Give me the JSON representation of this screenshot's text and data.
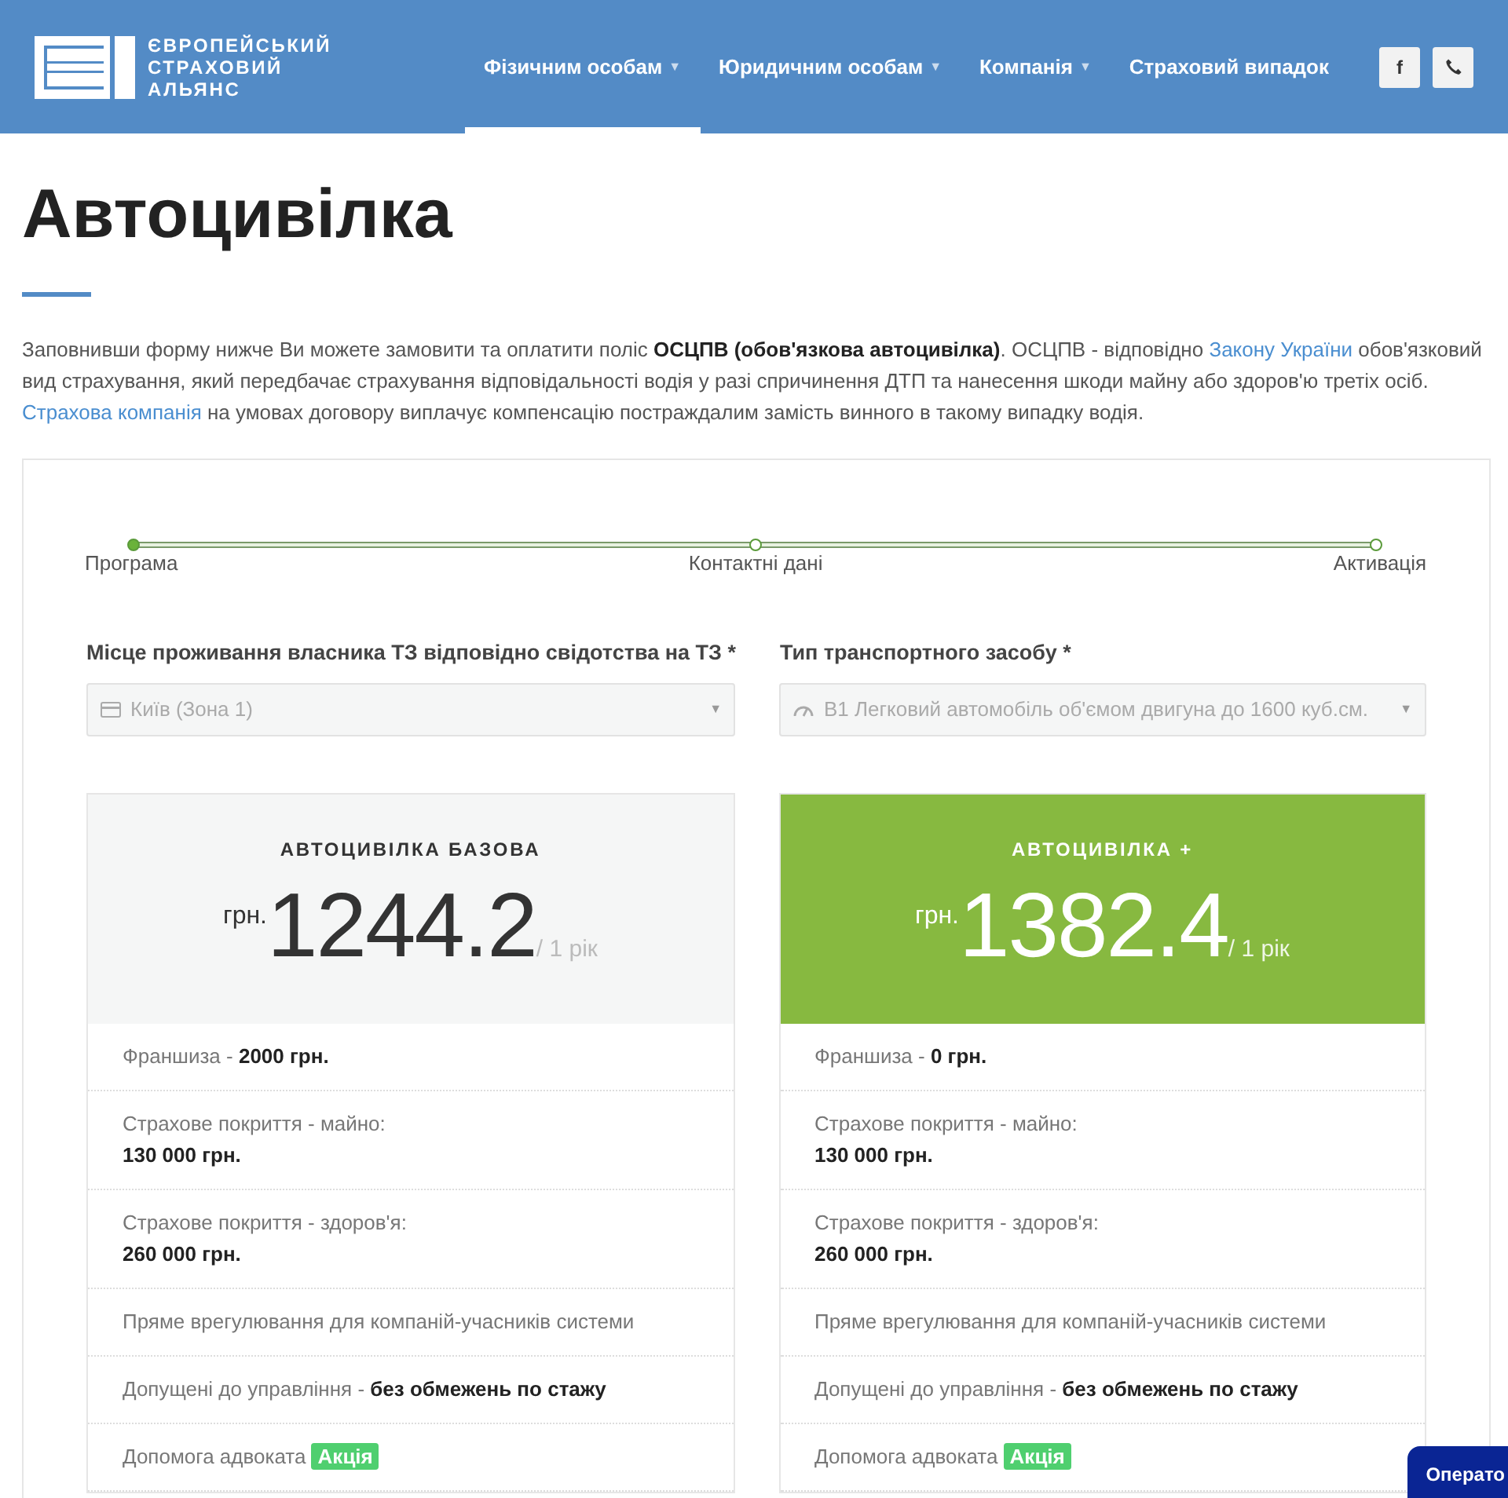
{
  "logo": {
    "lines": [
      "ЄВРОПЕЙСЬКИЙ",
      "СТРАХОВИЙ",
      "АЛЬЯНС"
    ]
  },
  "menu": [
    {
      "label": "Фізичним особам",
      "caret": "▼",
      "selected": true
    },
    {
      "label": "Юридичним особам",
      "caret": "▼",
      "selected": false
    },
    {
      "label": "Компанія",
      "caret": "▼",
      "selected": false
    },
    {
      "label": "Страховий випадок",
      "selected": false
    }
  ],
  "social": [
    {
      "kind": "facebook",
      "glyph": "f"
    },
    {
      "kind": "phone"
    }
  ],
  "title": "Автоцивілка",
  "intro": [
    {
      "kind": "text",
      "text": "Заповнивши форму нижче Ви можете замовити та оплатити поліс "
    },
    {
      "kind": "bold",
      "text": "ОСЦПВ (обов'язкова автоцивілка)"
    },
    {
      "kind": "text",
      "text": ". ОСЦПВ - відповідно "
    },
    {
      "kind": "link",
      "text": "Закону України"
    },
    {
      "kind": "text",
      "text": " обов'язковий вид страхування, який передбачає страхування відповідальності водія у разі спричинення ДТП та нанесення шкоди майну або здоров'ю третіх осіб. "
    },
    {
      "kind": "link",
      "text": "Страхова компанія"
    },
    {
      "kind": "text",
      "text": " на умовах договору виплачує компенсацію постраждалим замість винного в такому випадку водія."
    }
  ],
  "steps": [
    {
      "label": "Програма",
      "reached": true
    },
    {
      "label": "Контактні дані",
      "reached": false
    },
    {
      "label": "Активація",
      "reached": false
    }
  ],
  "fields": [
    {
      "label": "Місце проживання власника ТЗ відповідно свідотства на ТЗ *",
      "value": "Київ (Зона 1)",
      "kind": "region",
      "caret": "▼"
    },
    {
      "label": "Тип транспортного засобу *",
      "value": "B1 Легковий автомобіль об'ємом двигуна до 1600 куб.см.",
      "kind": "vehicle",
      "caret": "▼"
    }
  ],
  "plans": [
    {
      "name": "АВТОЦИВІЛКА БАЗОВА",
      "featured": false,
      "currency": "грн.",
      "price": "1244.2",
      "period": "/ 1 рік",
      "features": [
        {
          "kind": "inline",
          "label": "Франшиза - ",
          "value": "2000 грн."
        },
        {
          "kind": "stacked",
          "label": "Страхове покриття - майно:",
          "value": "130 000 грн."
        },
        {
          "kind": "stacked",
          "label": "Страхове покриття - здоров'я:",
          "value": "260 000 грн."
        },
        {
          "kind": "plain",
          "label": "Пряме врегулювання для компаній-учасників системи"
        },
        {
          "kind": "inline",
          "label": "Допущені до управління - ",
          "value": "без обмежень по стажу"
        },
        {
          "kind": "badge",
          "label": "Допомога адвоката ",
          "badge": "Акція"
        }
      ]
    },
    {
      "name": "АВТОЦИВІЛКА +",
      "featured": true,
      "currency": "грн.",
      "price": "1382.4",
      "period": "/ 1 рік",
      "features": [
        {
          "kind": "inline",
          "label": "Франшиза - ",
          "value": "0 грн."
        },
        {
          "kind": "stacked",
          "label": "Страхове покриття - майно:",
          "value": "130 000 грн."
        },
        {
          "kind": "stacked",
          "label": "Страхове покриття - здоров'я:",
          "value": "260 000 грн."
        },
        {
          "kind": "plain",
          "label": "Пряме врегулювання для компаній-учасників системи"
        },
        {
          "kind": "inline",
          "label": "Допущені до управління - ",
          "value": "без обмежень по стажу"
        },
        {
          "kind": "badge",
          "label": "Допомога адвоката ",
          "badge": "Акція"
        }
      ]
    }
  ],
  "chat": {
    "label": "Операто"
  }
}
